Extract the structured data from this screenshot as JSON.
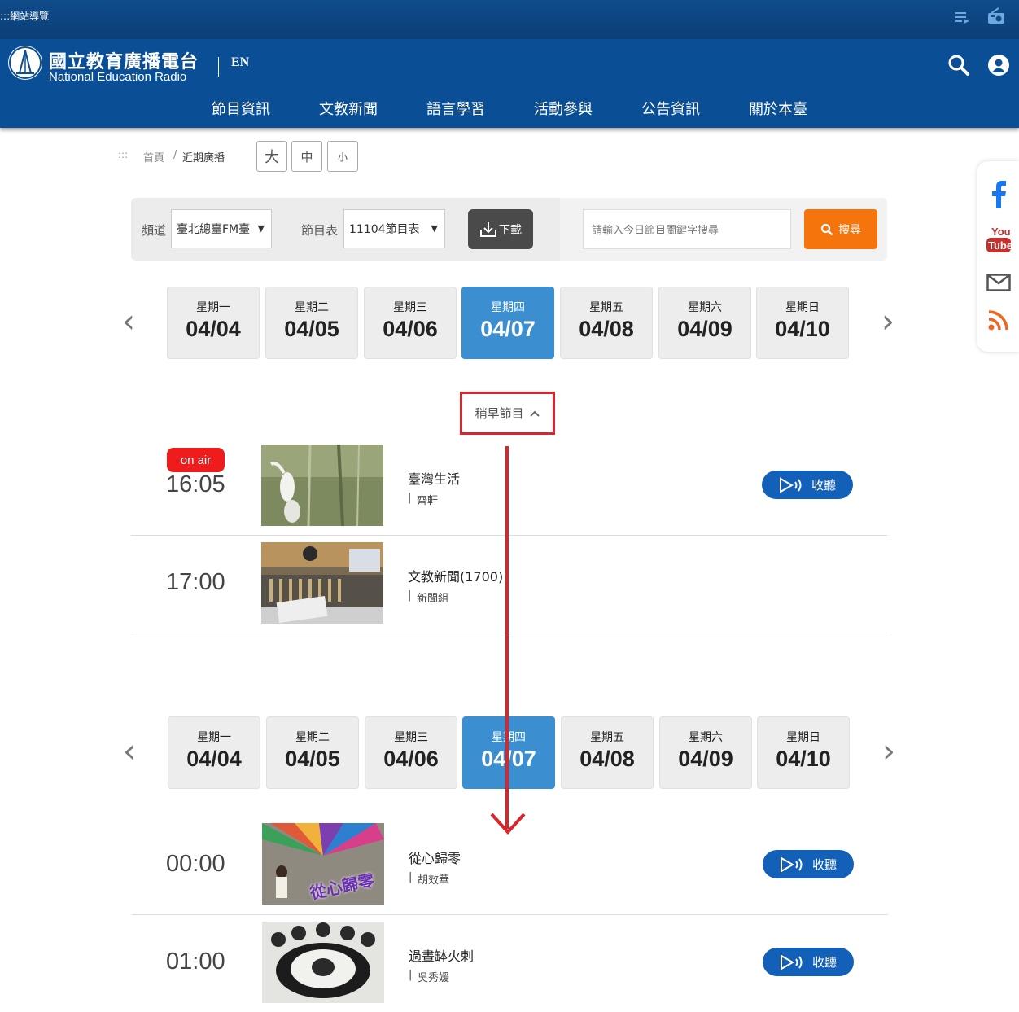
{
  "topbar": {
    "nav_guide": ":::網站導覽"
  },
  "header": {
    "logo_cn": "國立教育廣播電台",
    "logo_en": "National Education Radio",
    "lang": "EN",
    "menu": [
      "節目資訊",
      "文教新聞",
      "語言學習",
      "活動參與",
      "公告資訊",
      "關於本臺"
    ]
  },
  "breadcrumb": {
    "dots": ":::",
    "home": "首頁",
    "sep": "/",
    "current": "近期廣播"
  },
  "font_size": {
    "large": "大",
    "medium": "中",
    "small": "小"
  },
  "filter": {
    "channel_label": "頻道",
    "channel_value": "臺北總臺FM臺",
    "schedule_label": "節目表",
    "schedule_value": "11104節目表",
    "download_label": "下載",
    "search_placeholder": "請輸入今日節目關鍵字搜尋",
    "search_button": "搜尋"
  },
  "days": [
    {
      "weekday": "星期一",
      "date": "04/04"
    },
    {
      "weekday": "星期二",
      "date": "04/05"
    },
    {
      "weekday": "星期三",
      "date": "04/06"
    },
    {
      "weekday": "星期四",
      "date": "04/07",
      "active": true
    },
    {
      "weekday": "星期五",
      "date": "04/08"
    },
    {
      "weekday": "星期六",
      "date": "04/09"
    },
    {
      "weekday": "星期日",
      "date": "04/10"
    }
  ],
  "earlier_label": "稍早節目",
  "on_air_label": "on air",
  "listen_label": "收聽",
  "programs_top": [
    {
      "time": "16:05",
      "title": "臺灣生活",
      "host": "齊軒",
      "on_air": true
    },
    {
      "time": "17:00",
      "title": "文教新聞(1700)",
      "host": "新聞組"
    }
  ],
  "programs_bottom": [
    {
      "time": "00:00",
      "title": "從心歸零",
      "host": "胡效華",
      "thumb_text": "從心歸零"
    },
    {
      "time": "01:00",
      "title": "過晝缽火剌",
      "host": "吳秀媛"
    }
  ],
  "colors": {
    "header": "#0a4f96",
    "active_day": "#3b8fd1",
    "search": "#f5740c",
    "listen": "#1360b8",
    "annotation": "#d9262c",
    "on_air": "#ee1c1c"
  }
}
